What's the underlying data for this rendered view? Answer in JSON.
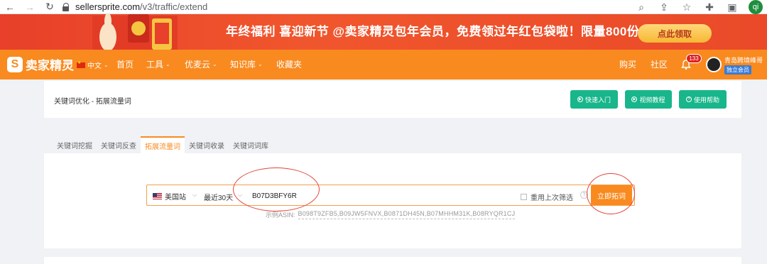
{
  "browser": {
    "url_host": "sellersprite.com",
    "url_path": "/v3/traffic/extend",
    "profile_initials": "qi"
  },
  "banner": {
    "text": "年终福利 喜迎新节 @卖家精灵包年会员，免费领过年红包袋啦！限量800份",
    "button_label": "点此领取"
  },
  "nav": {
    "logo_text": "卖家精灵",
    "language": "中文",
    "items": [
      {
        "label": "首页",
        "dropdown": false
      },
      {
        "label": "工具",
        "dropdown": true
      },
      {
        "label": "优麦云",
        "dropdown": true
      },
      {
        "label": "知识库",
        "dropdown": true
      },
      {
        "label": "收藏夹",
        "dropdown": false
      }
    ],
    "buy": "购买",
    "community": "社区",
    "notification_count": "133",
    "user_name": "青岛跨境峰哥",
    "member_badge": "独立会员"
  },
  "page": {
    "breadcrumb": "关键词优化 - 拓展流量词",
    "header_buttons": [
      {
        "label": "快速入门",
        "icon": "play-icon"
      },
      {
        "label": "视频教程",
        "icon": "play-icon"
      },
      {
        "label": "使用帮助",
        "icon": "help-icon"
      }
    ],
    "tabs": [
      {
        "label": "关键词挖掘",
        "active": false
      },
      {
        "label": "关键词反查",
        "active": false
      },
      {
        "label": "拓展流量词",
        "active": true
      },
      {
        "label": "关键词收录",
        "active": false
      },
      {
        "label": "关键词词库",
        "active": false
      }
    ]
  },
  "search": {
    "market": "美国站",
    "range": "最近30天",
    "value": "B07D3BFY6R",
    "reuse_label": "重用上次筛选",
    "submit_label": "立即拓词",
    "example_label": "示例ASIN:",
    "example_asins": "B098T9ZFB5,B09JW5FNVX,B0871DH45N,B07MHHM31K,B08RYQR1CJ"
  },
  "colors": {
    "brand_orange": "#f98a1f",
    "banner_red": "#ea4a29",
    "teal": "#18b68a",
    "annotation_red": "#e2453a"
  }
}
